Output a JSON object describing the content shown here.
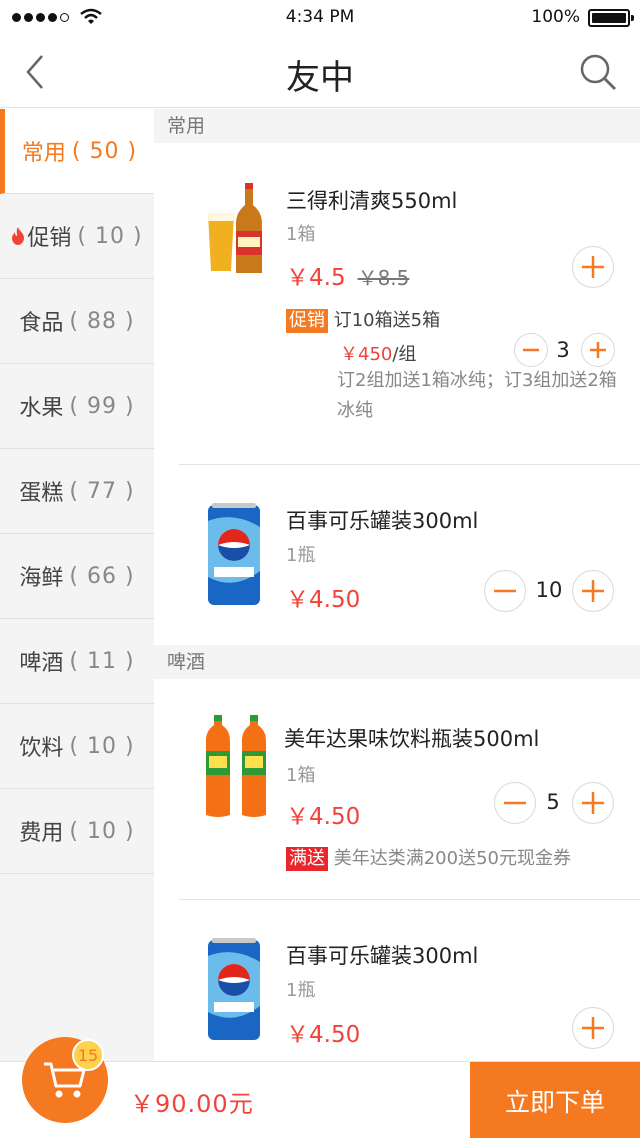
{
  "status_bar": {
    "time": "4:34 PM",
    "battery": "100%"
  },
  "nav": {
    "title": "友中",
    "back_icon": "chevron-left-icon",
    "search_icon": "search-icon"
  },
  "colors": {
    "accent": "#f47920",
    "price_red": "#f2433b",
    "promo_red": "#e8262c"
  },
  "sidebar": {
    "items": [
      {
        "label": "常用",
        "count": "( 50 )",
        "active": true
      },
      {
        "label": "促销",
        "count": "( 10 )",
        "hot": true
      },
      {
        "label": "食品",
        "count": "( 88 )"
      },
      {
        "label": "水果",
        "count": "( 99 )"
      },
      {
        "label": "蛋糕",
        "count": "( 77 )"
      },
      {
        "label": "海鲜",
        "count": "( 66 )"
      },
      {
        "label": "啤酒",
        "count": "( 11 )"
      },
      {
        "label": "饮料",
        "count": "( 10 )"
      },
      {
        "label": "费用",
        "count": "( 10 )"
      }
    ]
  },
  "sections": [
    {
      "title": "常用"
    },
    {
      "title": "啤酒"
    }
  ],
  "products": [
    {
      "name": "三得利清爽550ml",
      "unit": "1箱",
      "price": "￥4.5",
      "old_price": "￥8.5",
      "image": "beer-bottle-glass-image",
      "promo": {
        "tag": "促销",
        "text": "订10箱送5箱",
        "price": "￥450",
        "price_unit": "/组",
        "note": "订2组加送1箱冰纯；订3组加送2箱冰纯",
        "quantity": "3"
      }
    },
    {
      "name": "百事可乐罐装300ml",
      "unit": "1瓶",
      "price": "￥4.50",
      "image": "pepsi-can-image",
      "quantity": "10"
    },
    {
      "name": "美年达果味饮料瓶装500ml",
      "unit": "1箱",
      "price": "￥4.50",
      "image": "mirinda-bottles-image",
      "quantity": "5",
      "gift": {
        "tag": "满送",
        "text": "美年达类满200送50元现金券"
      }
    },
    {
      "name": "百事可乐罐装300ml",
      "unit": "1瓶",
      "price": "￥4.50",
      "image": "pepsi-can-image"
    }
  ],
  "bottom_bar": {
    "cart_count": "15",
    "total": "￥90.00元",
    "order_button": "立即下单"
  }
}
